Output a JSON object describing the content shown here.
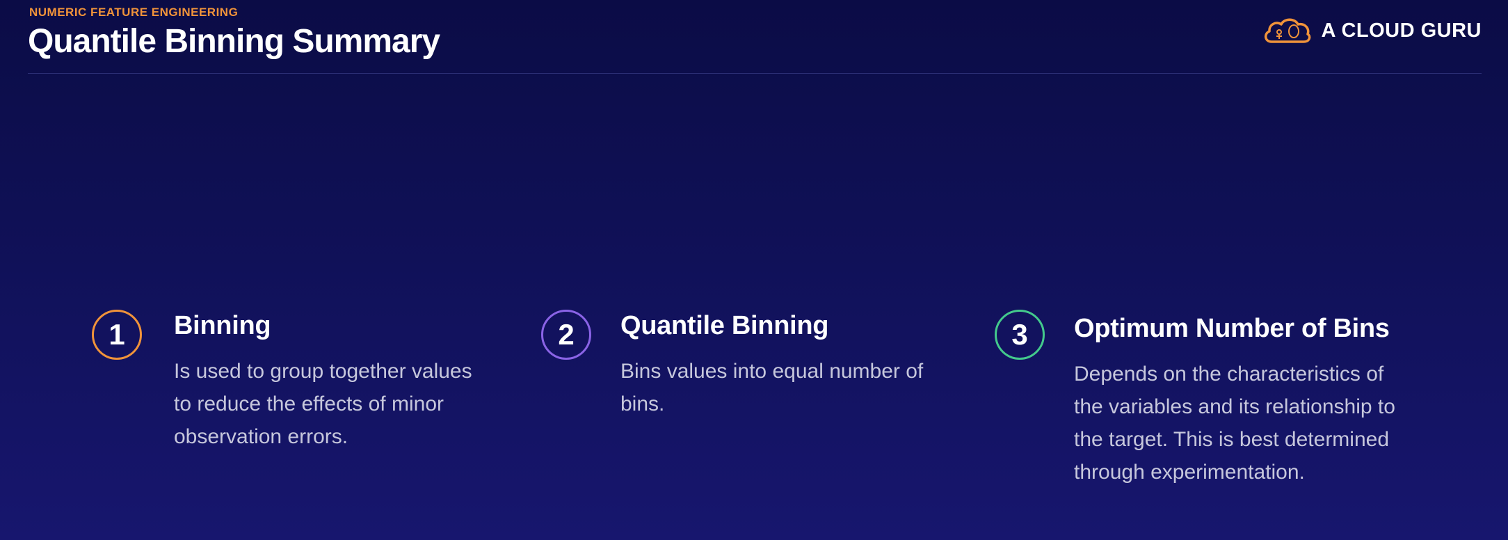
{
  "header": {
    "kicker": "NUMERIC FEATURE ENGINEERING",
    "title": "Quantile Binning Summary"
  },
  "brand": {
    "logo_icon": "cloud-logo-icon",
    "name": "A CLOUD GURU",
    "accent_color": "#f0933a"
  },
  "points": [
    {
      "number": "1",
      "heading": "Binning",
      "lines": [
        "Is used to group together values",
        "to reduce the effects of minor",
        "observation errors."
      ],
      "color": "#f0933a"
    },
    {
      "number": "2",
      "heading": "Quantile Binning",
      "lines": [
        "Bins values into equal number of",
        "bins."
      ],
      "color": "#8a63e6"
    },
    {
      "number": "3",
      "heading": "Optimum Number of Bins",
      "lines": [
        "Depends on the characteristics of",
        "the variables and its relationship to",
        "the target. This is best determined",
        "through experimentation."
      ],
      "color": "#43c98c"
    }
  ]
}
